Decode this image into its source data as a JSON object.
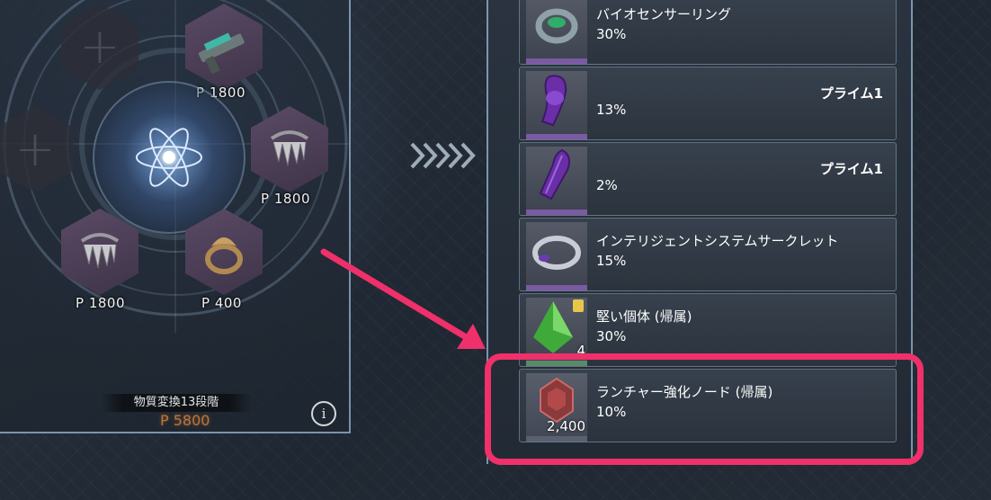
{
  "fusion": {
    "slots": [
      {
        "state": "empty",
        "price": ""
      },
      {
        "state": "filled",
        "item_icon": "rifle-icon",
        "price": "P 1800"
      },
      {
        "state": "empty",
        "price": ""
      },
      {
        "state": "filled",
        "item_icon": "claw-necklace-icon",
        "price": "P 1800"
      },
      {
        "state": "filled",
        "item_icon": "claw-necklace-icon",
        "price": "P 1800"
      },
      {
        "state": "filled",
        "item_icon": "ornate-ring-icon",
        "price": "P 400"
      }
    ],
    "core_icon": "atom-icon",
    "stage_label": "物質変換13段階",
    "total_cost": "P 5800",
    "info_icon": "i"
  },
  "arrow_icon": "chevron-right-icon",
  "results": [
    {
      "name": "バイオセンサーリング",
      "tag": "",
      "percent": "30%",
      "icon": "biosensor-ring-icon",
      "qty": ""
    },
    {
      "name": "",
      "tag": "プライム1",
      "percent": "13%",
      "icon": "purple-leg-armor-icon",
      "qty": ""
    },
    {
      "name": "",
      "tag": "プライム1",
      "percent": "2%",
      "icon": "purple-arm-armor-icon",
      "qty": ""
    },
    {
      "name": "インテリジェントシステムサークレット",
      "tag": "",
      "percent": "15%",
      "icon": "circlet-ring-icon",
      "qty": ""
    },
    {
      "name": "堅い個体 (帰属)",
      "tag": "",
      "percent": "30%",
      "icon": "green-crystal-icon",
      "qty": "4"
    },
    {
      "name": "ランチャー強化ノード (帰属)",
      "tag": "",
      "percent": "10%",
      "icon": "launcher-node-icon",
      "qty": "2,400"
    }
  ],
  "colors": {
    "highlight": "#f0306a",
    "cost": "#f0903a",
    "rarity_purple": "#7b5aa4"
  }
}
